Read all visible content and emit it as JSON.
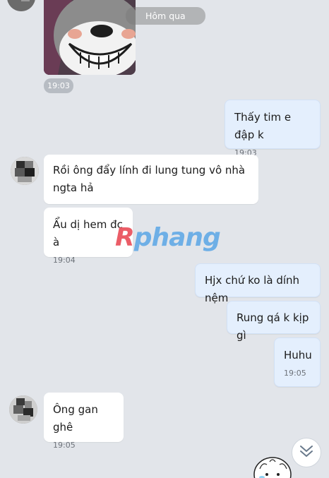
{
  "date_divider": "Hôm qua",
  "sticker_time": "19:03",
  "watermark": {
    "r": "R",
    "rest": "phang"
  },
  "messages": [
    {
      "id": "m1",
      "dir": "out",
      "text": "Thấy tim e đập k",
      "time": "19:03"
    },
    {
      "id": "m2",
      "dir": "in",
      "text": "Rồi ông đẩy lính đi lung tung vô nhà ngta hả",
      "time": ""
    },
    {
      "id": "m3",
      "dir": "in",
      "text": "Ẩu dị hem đc à",
      "time": "19:04"
    },
    {
      "id": "m4",
      "dir": "out",
      "text": "Hjx chứ ko là dính nệm",
      "time": ""
    },
    {
      "id": "m5",
      "dir": "out",
      "text": "Rung qá k kịp gì",
      "time": ""
    },
    {
      "id": "m6",
      "dir": "out",
      "text": "Huhu",
      "time": "19:05"
    },
    {
      "id": "m7",
      "dir": "in",
      "text": "Ông gan ghê",
      "time": "19:05"
    }
  ],
  "icons": {
    "scroll_down": "chevron-double-down-icon",
    "avatar": "blurred-avatar"
  }
}
